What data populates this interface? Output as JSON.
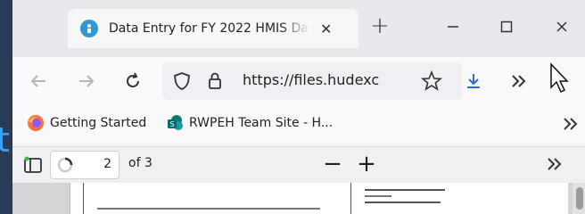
{
  "tab": {
    "title": "Data Entry for FY 2022 HMIS Da",
    "close_glyph": "✕"
  },
  "window_controls": {
    "new_tab_glyph": "+"
  },
  "address_bar": {
    "url": "https://files.hudexc"
  },
  "bookmarks": [
    {
      "label": "Getting Started",
      "icon": "firefox-icon"
    },
    {
      "label": "RWPEH Team Site - H...",
      "icon": "sharepoint-icon"
    }
  ],
  "pdf_toolbar": {
    "page_number": "2",
    "of_pages": "of 3",
    "zoom_out_glyph": "−",
    "zoom_in_glyph": "+"
  },
  "colors": {
    "accent": "#2f9ad7",
    "tabbar_bg": "#e7e9ee",
    "toolbar_bg": "#f9f9fb",
    "download_icon": "#2a6fd6"
  }
}
